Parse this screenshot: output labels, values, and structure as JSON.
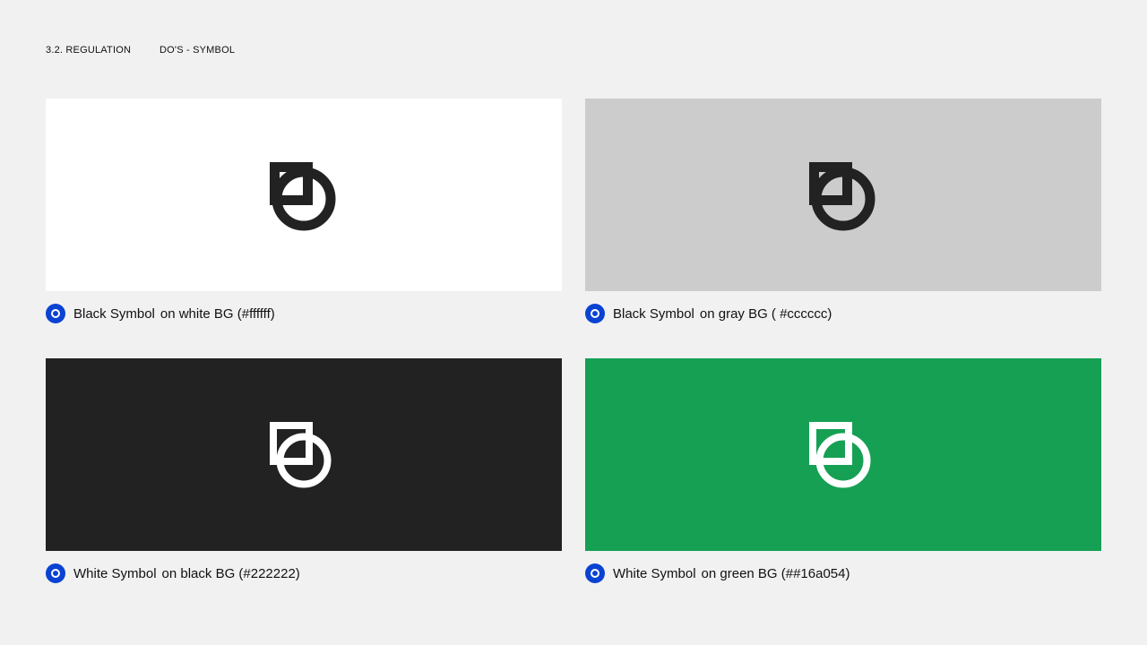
{
  "header": {
    "section": "3.2. REGULATION",
    "title": "DO'S - SYMBOL"
  },
  "colors": {
    "page_bg": "#f1f1f1",
    "check_icon": "#0a42d2",
    "symbol_black": "#222222",
    "symbol_white": "#ffffff"
  },
  "examples": [
    {
      "bg": "#ffffff",
      "symbol_color": "#222222",
      "symbol_label": "Black Symbol",
      "bg_label": "on white BG (#ffffff)"
    },
    {
      "bg": "#cccccc",
      "symbol_color": "#222222",
      "symbol_label": "Black Symbol",
      "bg_label": "on gray BG ( #cccccc)"
    },
    {
      "bg": "#222222",
      "symbol_color": "#ffffff",
      "symbol_label": "White Symbol",
      "bg_label": "on black BG (#222222)"
    },
    {
      "bg": "#16a054",
      "symbol_color": "#ffffff",
      "symbol_label": "White Symbol",
      "bg_label": "on green BG (##16a054)"
    }
  ]
}
